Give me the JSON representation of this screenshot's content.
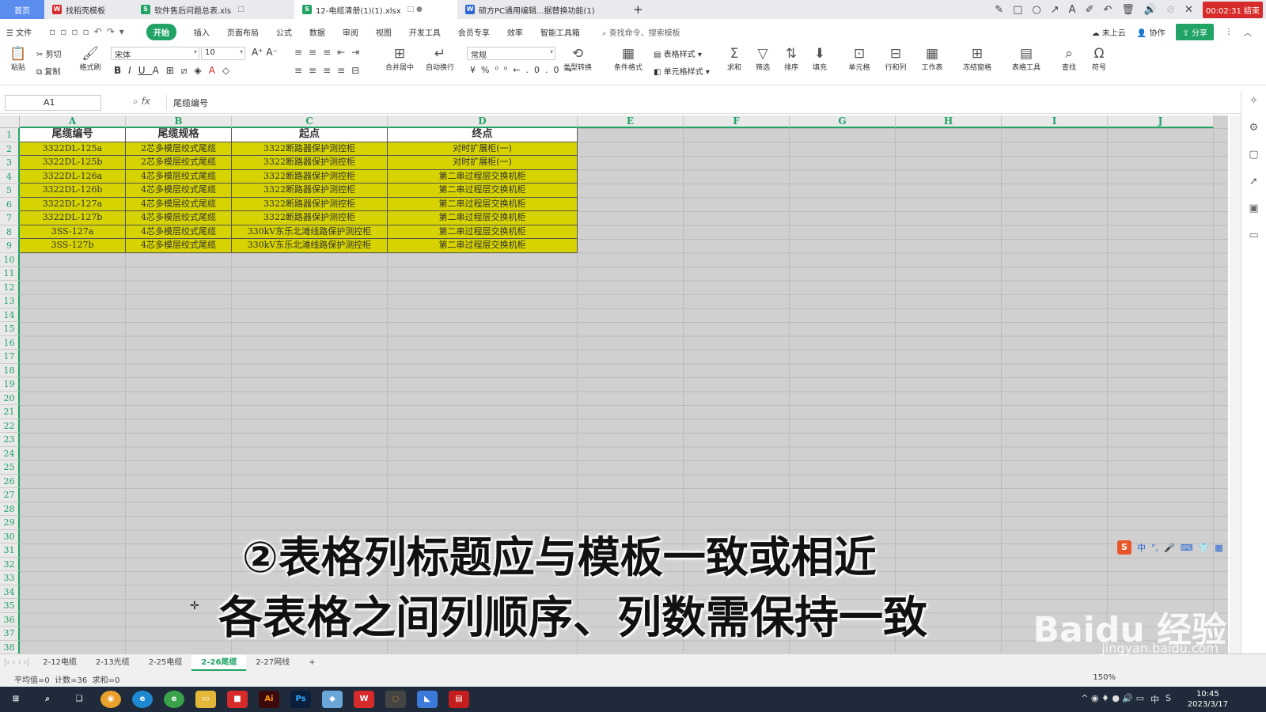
{
  "window_tabs": [
    {
      "label": "首页",
      "type": "home"
    },
    {
      "label": "找稻壳模板",
      "icon": "wps",
      "color": "#d72a2a"
    },
    {
      "label": "软件售后问题总表.xls",
      "icon": "S",
      "color": "#21a366"
    },
    {
      "label": "12-电缆清册(1)(1).xlsx",
      "icon": "S",
      "color": "#21a366",
      "active": true
    },
    {
      "label": "硕方PC通用编辑...据替换功能(1)",
      "icon": "W",
      "color": "#2d66d8"
    }
  ],
  "timer_text": "00:02:31 结束",
  "menu": {
    "file": "文件",
    "items": [
      "开始",
      "插入",
      "页面布局",
      "公式",
      "数据",
      "审阅",
      "视图",
      "开发工具",
      "会员专享",
      "效率",
      "智能工具箱"
    ],
    "search": "查找命令、搜索模板",
    "cloud": "未上云",
    "collab": "协作",
    "share": "分享"
  },
  "ribbon": {
    "paste": "粘贴",
    "cut": "剪切",
    "copy": "复制",
    "format_painter": "格式刷",
    "font_name": "宋体",
    "font_size": "10",
    "number_format": "常规",
    "merge": "合并居中",
    "wrap": "自动换行",
    "convert": "类型转换",
    "cond_format": "条件格式",
    "table_style": "表格样式",
    "cell_style": "单元格样式",
    "sum": "求和",
    "filter": "筛选",
    "sort": "排序",
    "fill": "填充",
    "cell": "单元格",
    "rowcol": "行和列",
    "worksheet": "工作表",
    "freeze": "冻结窗格",
    "table_tools": "表格工具",
    "find": "查找",
    "symbol": "符号"
  },
  "formula_bar": {
    "name_box": "A1",
    "fx": "fx",
    "value": "尾缆编号"
  },
  "columns": [
    "A",
    "B",
    "C",
    "D",
    "E",
    "F",
    "G",
    "H",
    "I",
    "J"
  ],
  "row_numbers": [
    "1",
    "2",
    "3",
    "4",
    "5",
    "6",
    "7",
    "8",
    "9",
    "10",
    "11",
    "12",
    "13",
    "14",
    "15",
    "16",
    "17",
    "18",
    "19",
    "20",
    "21",
    "22",
    "23",
    "24",
    "25",
    "26",
    "27",
    "28",
    "29",
    "30",
    "31",
    "32",
    "33",
    "34",
    "35",
    "36",
    "37",
    "38"
  ],
  "table": {
    "headers": [
      "尾缆编号",
      "尾缆规格",
      "起点",
      "终点"
    ],
    "rows": [
      [
        "3322DL-125a",
        "2芯多模层绞式尾缆",
        "3322断路器保护测控柜",
        "对时扩展柜(一)"
      ],
      [
        "3322DL-125b",
        "2芯多模层绞式尾缆",
        "3322断路器保护测控柜",
        "对时扩展柜(一)"
      ],
      [
        "3322DL-126a",
        "4芯多模层绞式尾缆",
        "3322断路器保护测控柜",
        "第二串过程层交换机柜"
      ],
      [
        "3322DL-126b",
        "4芯多模层绞式尾缆",
        "3322断路器保护测控柜",
        "第二串过程层交换机柜"
      ],
      [
        "3322DL-127a",
        "4芯多模层绞式尾缆",
        "3322断路器保护测控柜",
        "第二串过程层交换机柜"
      ],
      [
        "3322DL-127b",
        "4芯多模层绞式尾缆",
        "3322断路器保护测控柜",
        "第二串过程层交换机柜"
      ],
      [
        "3SS-127a",
        "4芯多模层绞式尾缆",
        "330kV东乐北滩线路保护测控柜",
        "第二串过程层交换机柜"
      ],
      [
        "3SS-127b",
        "4芯多模层绞式尾缆",
        "330kV东乐北滩线路保护测控柜",
        "第二串过程层交换机柜"
      ]
    ],
    "data_fill": "#d6d300"
  },
  "sheet_tabs": [
    "2-12电缆",
    "2-13光缆",
    "2-25电缆",
    "2-26尾缆",
    "2-27网线"
  ],
  "active_sheet": "2-26尾缆",
  "status": {
    "avg": "平均值=0",
    "count": "计数=36",
    "sum": "求和=0",
    "zoom": "150%"
  },
  "overlay": {
    "line1": "②表格列标题应与模板一致或相近",
    "line2": "各表格之间列顺序、列数需保持一致"
  },
  "watermark": {
    "logo": "Baidu 经验",
    "url": "jingyan.baidu.com"
  },
  "clock": {
    "time": "10:45",
    "date": "2023/3/17"
  },
  "ime": {
    "lang": "中"
  }
}
